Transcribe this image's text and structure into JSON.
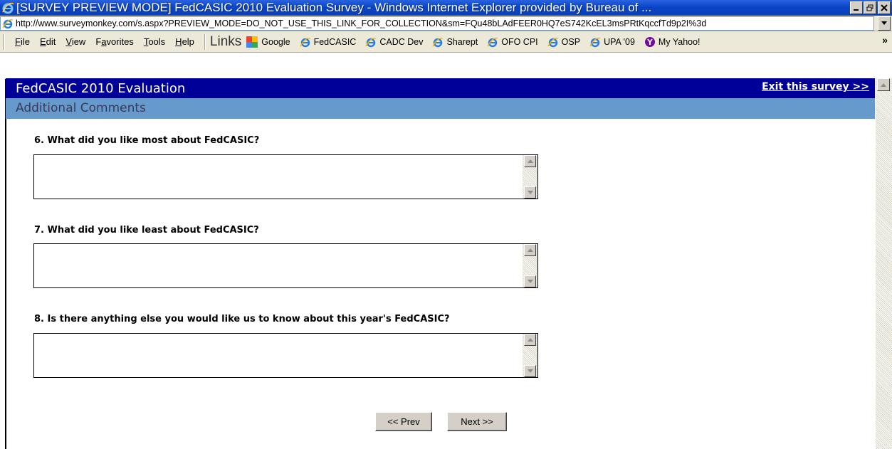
{
  "window": {
    "title": "[SURVEY PREVIEW MODE] FedCASIC 2010 Evaluation Survey - Windows Internet Explorer provided by Bureau of ..."
  },
  "address": {
    "url": "http://www.surveymonkey.com/s.aspx?PREVIEW_MODE=DO_NOT_USE_THIS_LINK_FOR_COLLECTION&sm=FQu48bLAdFEER0HQ7eS742KcEL3msPRtKqccfTd9p2I%3d"
  },
  "menu": {
    "items": [
      {
        "label": "File",
        "key": "F",
        "rest": "ile"
      },
      {
        "label": "Edit",
        "key": "E",
        "rest": "dit"
      },
      {
        "label": "View",
        "key": "V",
        "rest": "iew"
      },
      {
        "label": "Favorites",
        "pre": "F",
        "key": "a",
        "rest": "vorites"
      },
      {
        "label": "Tools",
        "key": "T",
        "rest": "ools"
      },
      {
        "label": "Help",
        "key": "H",
        "rest": "elp"
      }
    ],
    "links_label": "Links",
    "links": [
      {
        "label": "Google",
        "icon": "google-icon"
      },
      {
        "label": "FedCASIC",
        "icon": "ie-page-icon"
      },
      {
        "label": "CADC Dev",
        "icon": "ie-page-icon"
      },
      {
        "label": "Sharept",
        "icon": "ie-page-icon"
      },
      {
        "label": "OFO CPI",
        "icon": "ie-page-icon"
      },
      {
        "label": "OSP",
        "icon": "ie-page-icon"
      },
      {
        "label": "UPA '09",
        "icon": "ie-page-icon"
      },
      {
        "label": "My Yahoo!",
        "icon": "yahoo-icon"
      }
    ],
    "overflow": "»"
  },
  "survey": {
    "title": "FedCASIC 2010 Evaluation",
    "exit_label": "Exit this survey >>",
    "page_title": "Additional Comments",
    "questions": [
      {
        "label": "6. What did you like most about FedCASIC?",
        "value": ""
      },
      {
        "label": "7. What did you like least about FedCASIC?",
        "value": ""
      },
      {
        "label": "8. Is there anything else you would like us to know about this year's FedCASIC?",
        "value": ""
      }
    ],
    "prev_label": "<< Prev",
    "next_label": "Next >>"
  },
  "colors": {
    "titlebar": "#0a45c8",
    "survey_header": "#000099",
    "page_header": "#6699cc"
  }
}
